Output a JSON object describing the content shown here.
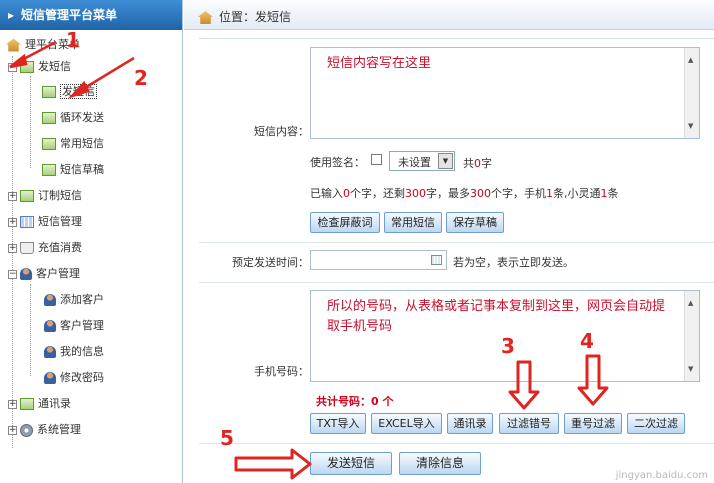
{
  "sidebar": {
    "title": "短信管理平台菜单",
    "root_label": "理平台菜单",
    "items": {
      "send": "发短信",
      "send_sub": "发短信",
      "loop": "循环发送",
      "common": "常用短信",
      "draft": "短信草稿",
      "order": "订制短信",
      "manage": "短信管理",
      "recharge": "充值消费",
      "customer": "客户管理",
      "add_customer": "添加客户",
      "customer_manage": "客户管理",
      "my_info": "我的信息",
      "change_pwd": "修改密码",
      "contacts": "通讯录",
      "system": "系统管理"
    }
  },
  "breadcrumb": "位置：发短信",
  "form": {
    "content_label": "短信内容：",
    "content_text": "短信内容写在这里",
    "sign_label": "使用签名：",
    "sign_select": "未设置",
    "count_prefix": "共",
    "count_value": "0",
    "count_suffix": "字",
    "stats": {
      "p1": "已输入",
      "input": "0",
      "p2": "个字，还剩",
      "remain": "300",
      "p3": "字，最多",
      "max": "300",
      "p4": "个字，手机",
      "mobile": "1",
      "p5": "条,小灵通",
      "phs": "1",
      "p6": "条"
    },
    "btn_check": "检查屏蔽词",
    "btn_common": "常用短信",
    "btn_draft": "保存草稿",
    "schedule_label": "预定发送时间：",
    "schedule_hint": "若为空，表示立即发送。",
    "phone_label": "手机号码：",
    "phone_text": "所以的号码，从表格或者记事本复制到这里，网页会自动提取手机号码",
    "total_label": "共计号码：0 个",
    "btn_txt": "TXT导入",
    "btn_excel": "EXCEL导入",
    "btn_contacts": "通讯录",
    "btn_filter_err": "过滤错号",
    "btn_dedupe": "重号过滤",
    "btn_second": "二次过滤",
    "btn_send": "发送短信",
    "btn_clear": "清除信息"
  },
  "annotations": [
    "1",
    "2",
    "3",
    "4",
    "5"
  ],
  "watermark": "jingyan.baidu.com",
  "colors": {
    "accent": "#2a6fb8",
    "annotation": "#e0241f",
    "highlight": "#d0021b"
  }
}
